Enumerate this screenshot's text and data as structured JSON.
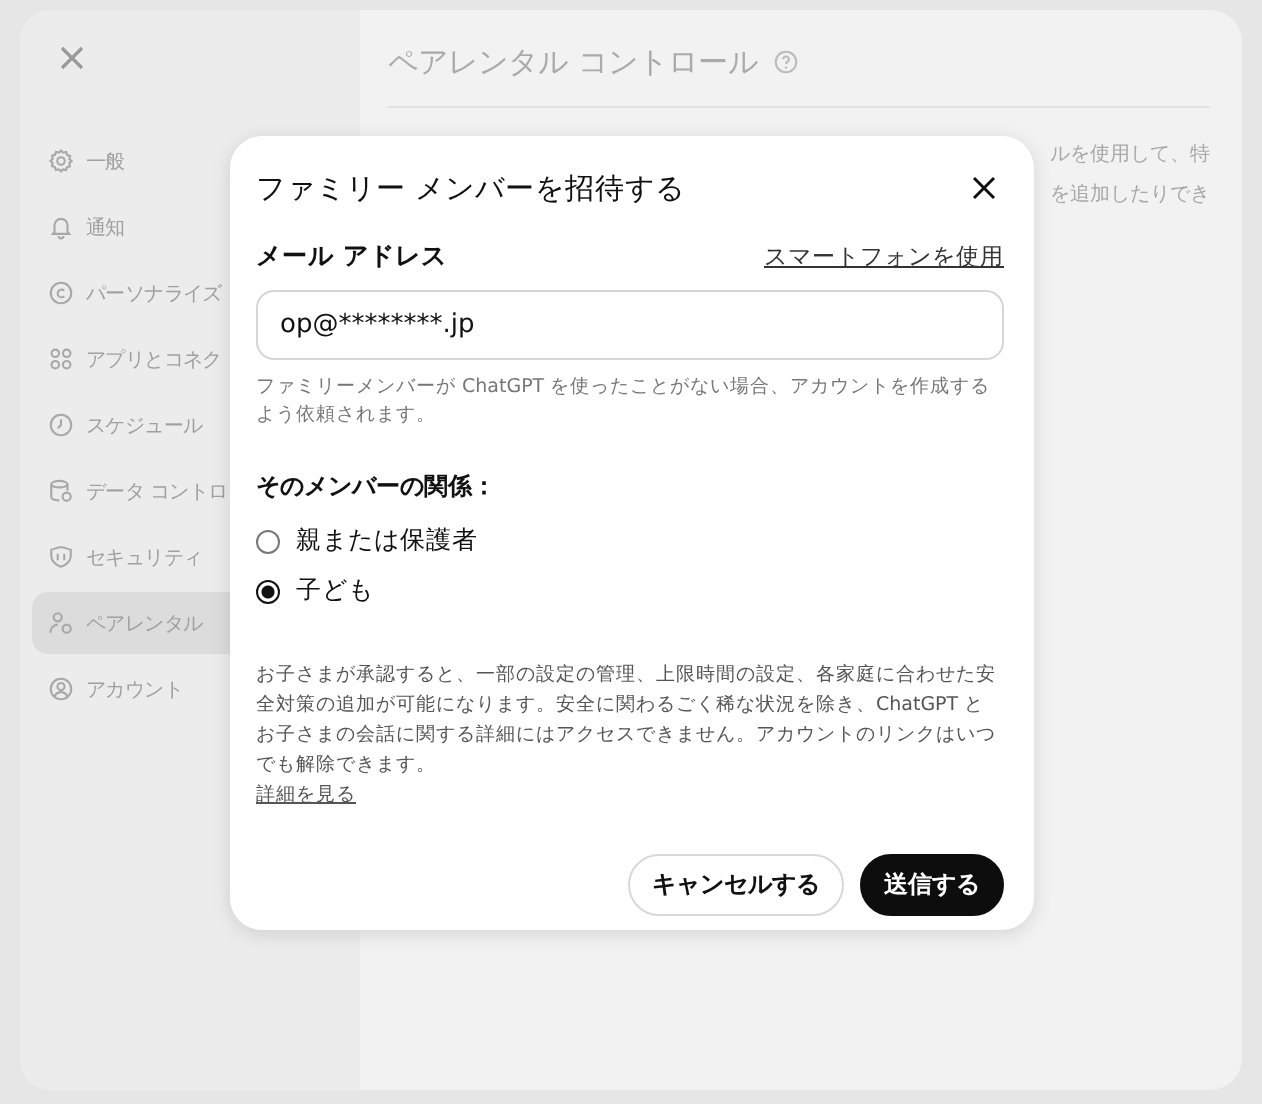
{
  "settings": {
    "sidebar": {
      "items": [
        {
          "label": "一般",
          "selected": false
        },
        {
          "label": "通知",
          "selected": false
        },
        {
          "label": "パーソナライズ",
          "selected": false
        },
        {
          "label": "アプリとコネク",
          "selected": false
        },
        {
          "label": "スケジュール",
          "selected": false
        },
        {
          "label": "データ コントロ",
          "selected": false
        },
        {
          "label": "セキュリティ",
          "selected": false
        },
        {
          "label": "ペアレンタル",
          "selected": true
        },
        {
          "label": "アカウント",
          "selected": false
        }
      ]
    },
    "main": {
      "title": "ペアレンタル コントロール",
      "description_lines": [
        "ルを使用して、特",
        "を追加したりでき"
      ]
    }
  },
  "dialog": {
    "title": "ファミリー メンバーを招待する",
    "email": {
      "label": "メール アドレス",
      "link": "スマートフォンを使用",
      "value": "op@********.jp",
      "hint": "ファミリーメンバーが ChatGPT を使ったことがない場合、アカウントを作成するよう依頼されます。"
    },
    "relation": {
      "label": "そのメンバーの関係：",
      "options": [
        {
          "label": "親または保護者",
          "selected": false
        },
        {
          "label": "子ども",
          "selected": true
        }
      ]
    },
    "info": "お子さまが承認すると、一部の設定の管理、上限時間の設定、各家庭に合わせた安全対策の追加が可能になります。安全に関わるごく稀な状況を除き、ChatGPT とお子さまの会話に関する詳細にはアクセスできません。アカウントのリンクはいつでも解除できます。",
    "info_link": "詳細を見る",
    "buttons": [
      {
        "label": "キャンセルする",
        "kind": "secondary"
      },
      {
        "label": "送信する",
        "kind": "primary"
      }
    ]
  }
}
